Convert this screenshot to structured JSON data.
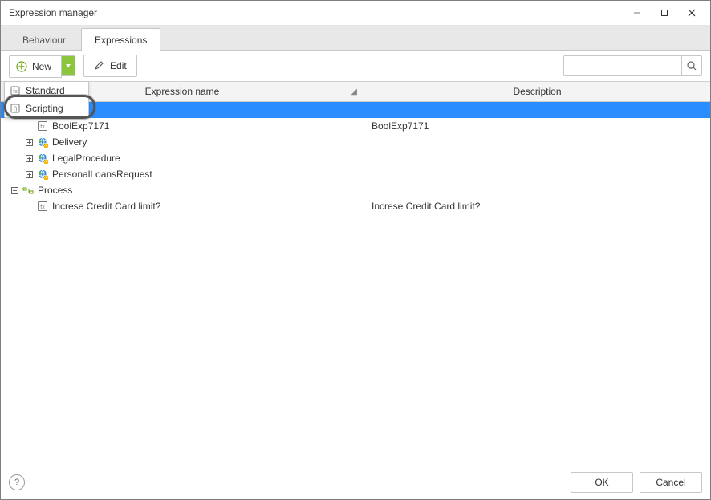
{
  "window": {
    "title": "Expression manager"
  },
  "tabs": {
    "behaviour": "Behaviour",
    "expressions": "Expressions",
    "active": "expressions"
  },
  "toolbar": {
    "new_label": "New",
    "edit_label": "Edit",
    "search_placeholder": ""
  },
  "new_menu": {
    "standard": "Standard",
    "scripting": "Scripting"
  },
  "grid": {
    "columns": {
      "name": "Expression name",
      "description": "Description"
    },
    "rows": [
      {
        "level": 0,
        "expandable": true,
        "expanded": true,
        "icon": "gear",
        "name": "",
        "desc": "",
        "selected": true
      },
      {
        "level": 1,
        "expandable": false,
        "expanded": false,
        "icon": "expr",
        "name": "BoolExp7171",
        "desc": "BoolExp7171",
        "selected": false
      },
      {
        "level": 1,
        "expandable": true,
        "expanded": false,
        "icon": "globe",
        "name": "Delivery",
        "desc": "",
        "selected": false
      },
      {
        "level": 1,
        "expandable": true,
        "expanded": false,
        "icon": "globe",
        "name": "LegalProcedure",
        "desc": "",
        "selected": false
      },
      {
        "level": 1,
        "expandable": true,
        "expanded": false,
        "icon": "globe",
        "name": "PersonalLoansRequest",
        "desc": "",
        "selected": false
      },
      {
        "level": 0,
        "expandable": true,
        "expanded": true,
        "icon": "proc",
        "name": "Process",
        "desc": "",
        "selected": false
      },
      {
        "level": 1,
        "expandable": false,
        "expanded": false,
        "icon": "expr",
        "name": "Increse Credit Card limit?",
        "desc": "Increse Credit Card limit?",
        "selected": false
      }
    ]
  },
  "footer": {
    "ok": "OK",
    "cancel": "Cancel",
    "help": "?"
  }
}
